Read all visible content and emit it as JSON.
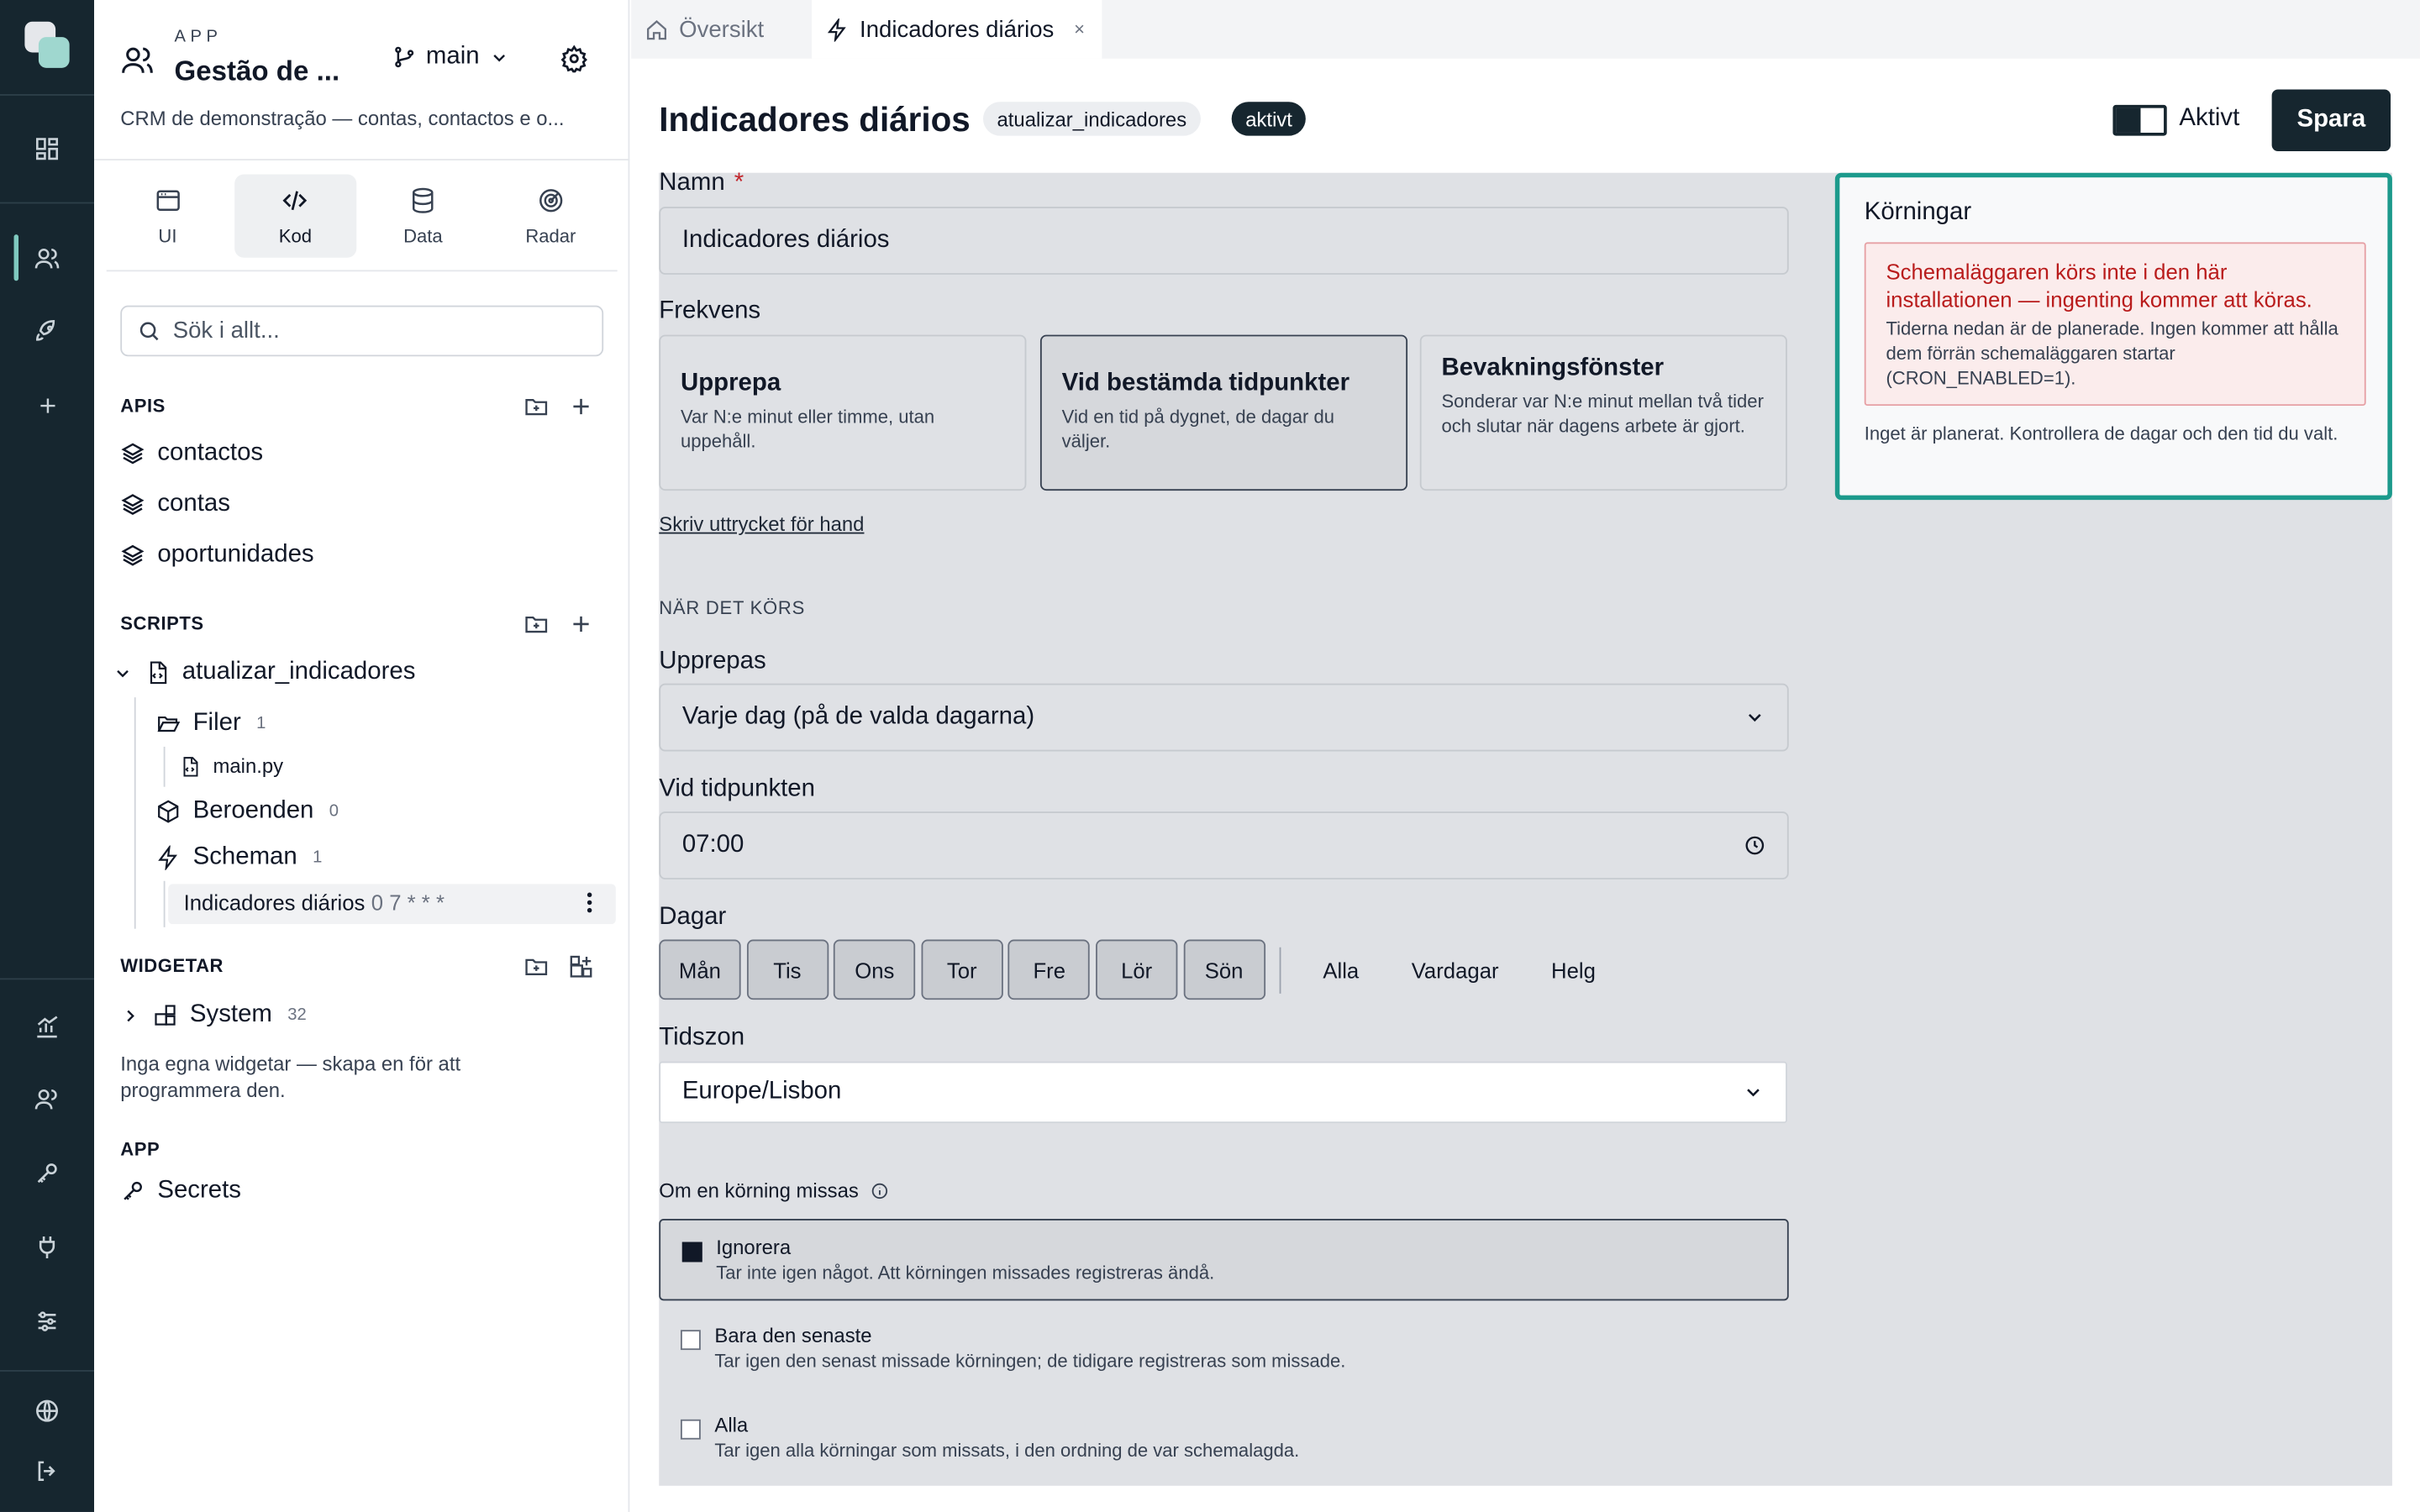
{
  "app": {
    "kicker": "APP",
    "title": "Gestão de ...",
    "branch": "main",
    "description": "CRM de demonstração — contas, contactos e o..."
  },
  "modes": [
    {
      "label": "UI",
      "icon": "window-icon"
    },
    {
      "label": "Kod",
      "icon": "code-icon"
    },
    {
      "label": "Data",
      "icon": "database-icon"
    },
    {
      "label": "Radar",
      "icon": "radar-icon"
    }
  ],
  "search": {
    "placeholder": "Sök i allt..."
  },
  "sections": {
    "apis": {
      "title": "APIS",
      "items": [
        "contactos",
        "contas",
        "oportunidades"
      ]
    },
    "scripts": {
      "title": "SCRIPTS",
      "script_name": "atualizar_indicadores",
      "files_label": "Filer",
      "files_count": "1",
      "file": "main.py",
      "deps_label": "Beroenden",
      "deps_count": "0",
      "schedules_label": "Scheman",
      "schedules_count": "1",
      "schedule_name": "Indicadores diários",
      "schedule_cron": "0 7 * * *"
    },
    "widgets": {
      "title": "WIDGETAR",
      "system_label": "System",
      "system_count": "32",
      "note": "Inga egna widgetar — skapa en för att programmera den."
    },
    "app": {
      "title": "APP",
      "secrets": "Secrets"
    }
  },
  "tabs": [
    {
      "label": "Översikt",
      "icon": "home-icon"
    },
    {
      "label": "Indicadores diários",
      "icon": "bolt-icon",
      "close": "×"
    }
  ],
  "header": {
    "title": "Indicadores diários",
    "script_pill": "atualizar_indicadores",
    "state_pill": "aktivt",
    "toggle_label": "Aktivt",
    "toggle_on": true,
    "save_label": "Spara"
  },
  "form": {
    "name_label": "Namn",
    "required_mark": "*",
    "name_value": "Indicadores diários",
    "frequency_label": "Frekvens",
    "frequency_options": [
      {
        "title": "Upprepa",
        "desc": "Var N:e minut eller timme, utan uppehåll.",
        "selected": false
      },
      {
        "title": "Vid bestämda tidpunkter",
        "desc": "Vid en tid på dygnet, de dagar du väljer.",
        "selected": true
      },
      {
        "title": "Bevakningsfönster",
        "desc": "Sonderar var N:e minut mellan två tider och slutar när dagens arbete är gjort.",
        "selected": false
      }
    ],
    "manual_link": "Skriv uttrycket för hand",
    "when_caption": "NÄR DET KÖRS",
    "repeat_label": "Upprepas",
    "repeat_value": "Varje dag (på de valda dagarna)",
    "time_label": "Vid tidpunkten",
    "time_value": "07:00",
    "days_label": "Dagar",
    "days": [
      "Mån",
      "Tis",
      "Ons",
      "Tor",
      "Fre",
      "Lör",
      "Sön"
    ],
    "day_shortcuts": [
      "Alla",
      "Vardagar",
      "Helg"
    ],
    "timezone_label": "Tidszon",
    "timezone_value": "Europe/Lisbon",
    "missed_label": "Om en körning missas",
    "missed_options": [
      {
        "title": "Ignorera",
        "desc": "Tar inte igen något. Att körningen missades registreras ändå.",
        "selected": true
      },
      {
        "title": "Bara den senaste",
        "desc": "Tar igen den senast missade körningen; de tidigare registreras som missade.",
        "selected": false
      },
      {
        "title": "Alla",
        "desc": "Tar igen alla körningar som missats, i den ordning de var schemalagda.",
        "selected": false
      }
    ]
  },
  "runs": {
    "title": "Körningar",
    "error_title": "Schemaläggaren körs inte i den här installationen — ingenting kommer att köras.",
    "error_body": "Tiderna nedan är de planerade. Ingen kommer att hålla dem förrän schemaläggaren startar (CRON_ENABLED=1).",
    "note": "Inget är planerat. Kontrollera de dagar och den tid du valt."
  },
  "colors": {
    "rail": "#16262f",
    "accent": "#1c9a8c",
    "error": "#b91c1c",
    "primary_button": "#16262f"
  }
}
